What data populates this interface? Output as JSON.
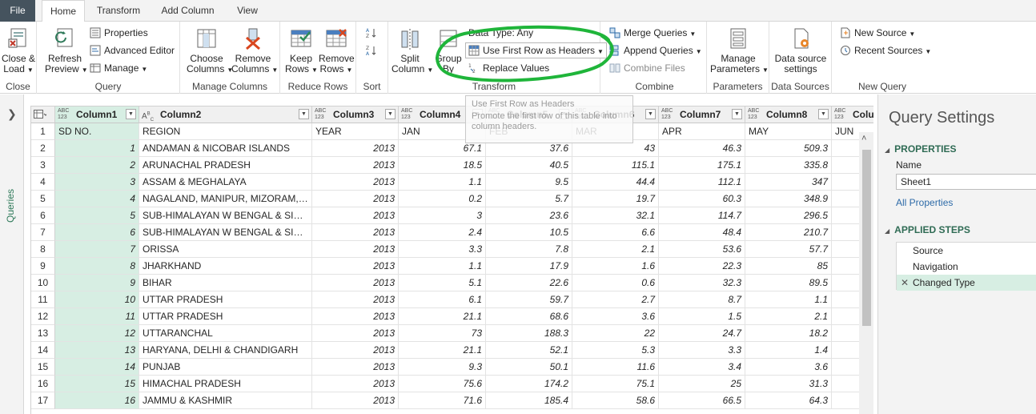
{
  "tabs": [
    "File",
    "Home",
    "Transform",
    "Add Column",
    "View"
  ],
  "ribbon": {
    "close": {
      "label1": "Close &",
      "label2": "Load",
      "group": "Close"
    },
    "query": {
      "refresh1": "Refresh",
      "refresh2": "Preview",
      "properties": "Properties",
      "advanced_editor": "Advanced Editor",
      "manage": "Manage",
      "group": "Query"
    },
    "manage_columns": {
      "choose1": "Choose",
      "choose2": "Columns",
      "remove1": "Remove",
      "remove2": "Columns",
      "group": "Manage Columns"
    },
    "reduce_rows": {
      "keep1": "Keep",
      "keep2": "Rows",
      "remove1": "Remove",
      "remove2": "Rows",
      "group": "Reduce Rows"
    },
    "sort": {
      "group": "Sort"
    },
    "transform": {
      "split1": "Split",
      "split2": "Column",
      "group_by1": "Group",
      "group_by2": "By",
      "data_type": "Data Type: Any",
      "use_first_row": "Use First Row as Headers",
      "replace_values": "Replace Values",
      "group": "Transform"
    },
    "combine": {
      "merge": "Merge Queries",
      "append": "Append Queries",
      "combine_files": "Combine Files",
      "group": "Combine"
    },
    "parameters": {
      "manage1": "Manage",
      "manage2": "Parameters",
      "group": "Parameters"
    },
    "data_sources": {
      "label1": "Data source",
      "label2": "settings",
      "group": "Data Sources"
    },
    "new_query": {
      "new_source": "New Source",
      "recent_sources": "Recent Sources",
      "group": "New Query"
    }
  },
  "left_pane": {
    "label": "Queries"
  },
  "tooltip": {
    "title": "Use First Row as Headers",
    "body": "Promote the first row of this table into column headers."
  },
  "grid": {
    "type_any": "ABC\n123",
    "type_text": "ABC",
    "columns": [
      "Column1",
      "Column2",
      "Column3",
      "Column4",
      "Column5",
      "Column6",
      "Column7",
      "Column8",
      "Colu"
    ],
    "rows": [
      [
        "1",
        "SD NO.",
        "REGION",
        "YEAR",
        "JAN",
        "FEB",
        "MAR",
        "APR",
        "MAY",
        "JUN"
      ],
      [
        "2",
        "1",
        "ANDAMAN & NICOBAR ISLANDS",
        "2013",
        "67.1",
        "37.6",
        "43",
        "46.3",
        "509.3",
        ""
      ],
      [
        "3",
        "2",
        "ARUNACHAL PRADESH",
        "2013",
        "18.5",
        "40.5",
        "115.1",
        "175.1",
        "335.8",
        ""
      ],
      [
        "4",
        "3",
        "ASSAM & MEGHALAYA",
        "2013",
        "1.1",
        "9.5",
        "44.4",
        "112.1",
        "347",
        ""
      ],
      [
        "5",
        "4",
        "NAGALAND, MANIPUR, MIZORAM,TRIPU...",
        "2013",
        "0.2",
        "5.7",
        "19.7",
        "60.3",
        "348.9",
        ""
      ],
      [
        "6",
        "5",
        "SUB-HIMALAYAN W BENGAL & SIKKIM",
        "2013",
        "3",
        "23.6",
        "32.1",
        "114.7",
        "296.5",
        ""
      ],
      [
        "7",
        "6",
        "SUB-HIMALAYAN W BENGAL & SIKKIM",
        "2013",
        "2.4",
        "10.5",
        "6.6",
        "48.4",
        "210.7",
        ""
      ],
      [
        "8",
        "7",
        "ORISSA",
        "2013",
        "3.3",
        "7.8",
        "2.1",
        "53.6",
        "57.7",
        ""
      ],
      [
        "9",
        "8",
        "JHARKHAND",
        "2013",
        "1.1",
        "17.9",
        "1.6",
        "22.3",
        "85",
        ""
      ],
      [
        "10",
        "9",
        "BIHAR",
        "2013",
        "5.1",
        "22.6",
        "0.6",
        "32.3",
        "89.5",
        ""
      ],
      [
        "11",
        "10",
        "UTTAR PRADESH",
        "2013",
        "6.1",
        "59.7",
        "2.7",
        "8.7",
        "1.1",
        ""
      ],
      [
        "12",
        "11",
        "UTTAR PRADESH",
        "2013",
        "21.1",
        "68.6",
        "3.6",
        "1.5",
        "2.1",
        ""
      ],
      [
        "13",
        "12",
        "UTTARANCHAL",
        "2013",
        "73",
        "188.3",
        "22",
        "24.7",
        "18.2",
        ""
      ],
      [
        "14",
        "13",
        "HARYANA, DELHI & CHANDIGARH",
        "2013",
        "21.1",
        "52.1",
        "5.3",
        "3.3",
        "1.4",
        ""
      ],
      [
        "15",
        "14",
        "PUNJAB",
        "2013",
        "9.3",
        "50.1",
        "11.6",
        "3.4",
        "3.6",
        ""
      ],
      [
        "16",
        "15",
        "HIMACHAL PRADESH",
        "2013",
        "75.6",
        "174.2",
        "75.1",
        "25",
        "31.3",
        ""
      ],
      [
        "17",
        "16",
        "JAMMU & KASHMIR",
        "2013",
        "71.6",
        "185.4",
        "58.6",
        "66.5",
        "64.3",
        ""
      ]
    ]
  },
  "settings": {
    "title": "Query Settings",
    "properties": "PROPERTIES",
    "name_label": "Name",
    "name_value": "Sheet1",
    "all_properties": "All Properties",
    "applied_steps": "APPLIED STEPS",
    "steps": [
      "Source",
      "Navigation",
      "Changed Type"
    ]
  },
  "colors": {
    "selected": "#d7eee3",
    "annotation": "#1fb53a",
    "accent": "#2f6b54"
  }
}
